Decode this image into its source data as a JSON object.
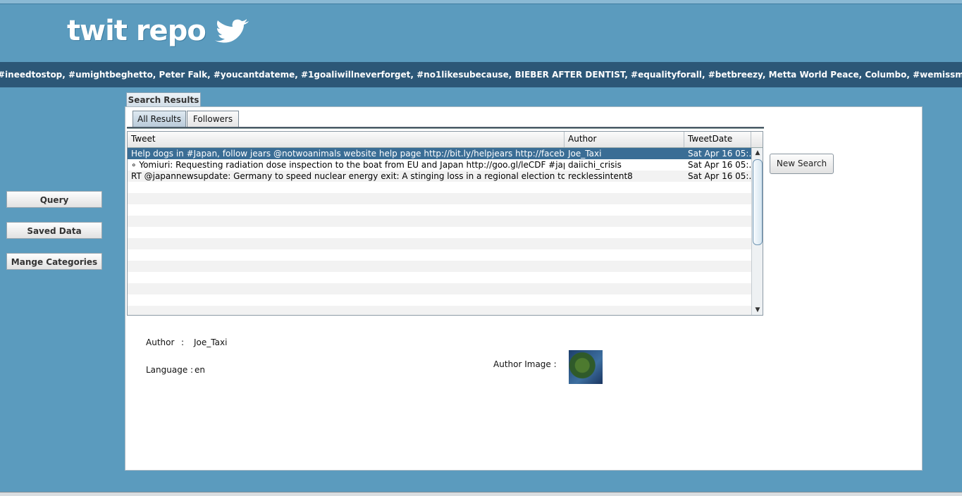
{
  "app": {
    "logo_text": "twit repo",
    "trending": "#ineedtostop, #umightbeghetto, Peter Falk, #youcantdateme, #1goaliwillneverforget, #no1likesubecause, BIEBER AFTER DENTIST, #equalityforall, #betbreezy, Metta World Peace, Columbo, #wemissmj, Fear God, #prayforthephilippines, #mioscura"
  },
  "sidebar": {
    "items": [
      {
        "label": "Query"
      },
      {
        "label": "Saved Data"
      },
      {
        "label": "Mange Categories"
      }
    ]
  },
  "main": {
    "outer_tab": "Search Results",
    "inner_tabs": [
      {
        "label": "All Results",
        "active": true
      },
      {
        "label": "Followers",
        "active": false
      }
    ],
    "table": {
      "columns": [
        "Tweet",
        "Author",
        "TweetDate"
      ],
      "rows": [
        {
          "tweet": "Help dogs in #Japan, follow jears @notwoanimals website help page http://bit.ly/helpjears  http://facebook.co...",
          "author": "Joe_Taxi",
          "date": "Sat Apr 16 05:...",
          "selected": true
        },
        {
          "tweet": "∘ Yomiuri: Requesting radiation dose inspection to the boat from EU and Japan http://goo.gl/leCDF #japan",
          "author": "daiichi_crisis",
          "date": "Sat Apr 16 05:...",
          "selected": false
        },
        {
          "tweet": "RT @japannewsupdate: Germany to speed nuclear energy exit: A stinging loss in a regional election to the pro...",
          "author": "recklessintent8",
          "date": "Sat Apr 16 05:...",
          "selected": false
        }
      ]
    },
    "new_search_label": "New Search",
    "details": {
      "author_label": "Author",
      "author_sep": ":",
      "author_value": "Joe_Taxi",
      "language_label": "Language :",
      "language_value": "en",
      "author_image_label": "Author Image :"
    }
  },
  "colors": {
    "background": "#5b9bbe",
    "ticker": "#2c5777",
    "selected_row": "#3a6d95"
  }
}
